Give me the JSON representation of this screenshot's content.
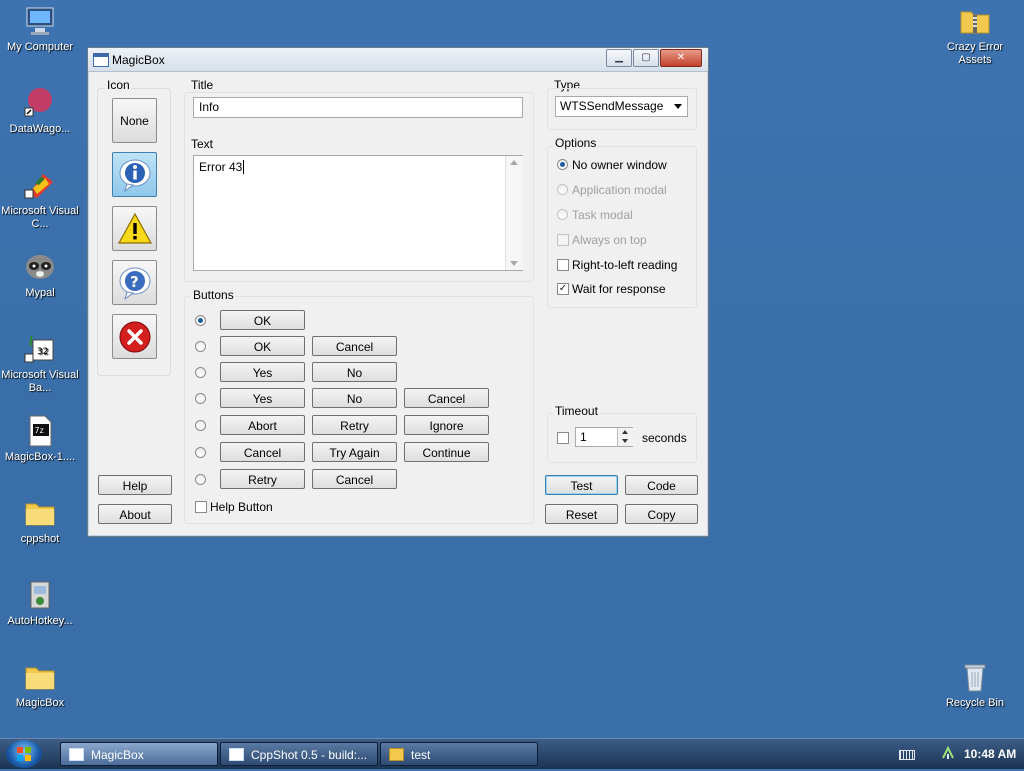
{
  "desktop": {
    "icons_left": [
      {
        "label": "My Computer"
      },
      {
        "label": "DataWago..."
      },
      {
        "label": "Microsoft Visual C..."
      },
      {
        "label": "Mypal"
      },
      {
        "label": "Microsoft Visual Ba..."
      },
      {
        "label": "MagicBox-1...."
      },
      {
        "label": "cppshot"
      },
      {
        "label": "AutoHotkey..."
      },
      {
        "label": "MagicBox"
      }
    ],
    "icons_right": [
      {
        "label": "Crazy Error Assets"
      },
      {
        "label": "Recycle Bin"
      }
    ]
  },
  "window": {
    "title": "MagicBox",
    "controls": {
      "minimize": "▁",
      "maximize": "▢",
      "close": "✕"
    },
    "icon_group": {
      "label": "Icon",
      "none_label": "None",
      "help_label": "Help",
      "about_label": "About"
    },
    "title_field": {
      "label": "Title",
      "value": "Info"
    },
    "text_field": {
      "label": "Text",
      "value": "Error 43"
    },
    "buttons_group": {
      "label": "Buttons",
      "rows": [
        [
          "OK"
        ],
        [
          "OK",
          "Cancel"
        ],
        [
          "Yes",
          "No"
        ],
        [
          "Yes",
          "No",
          "Cancel"
        ],
        [
          "Abort",
          "Retry",
          "Ignore"
        ],
        [
          "Cancel",
          "Try Again",
          "Continue"
        ],
        [
          "Retry",
          "Cancel"
        ]
      ],
      "help_button_label": "Help Button"
    },
    "type": {
      "label": "Type",
      "value": "WTSSendMessage"
    },
    "options": {
      "label": "Options",
      "no_owner": "No owner window",
      "app_modal": "Application modal",
      "task_modal": "Task modal",
      "always_on_top": "Always on top",
      "rtl": "Right-to-left reading",
      "wait": "Wait for response"
    },
    "timeout": {
      "label": "Timeout",
      "value": "1",
      "unit": "seconds"
    },
    "actions": {
      "test": "Test",
      "code": "Code",
      "reset": "Reset",
      "copy": "Copy"
    }
  },
  "taskbar": {
    "tasks": [
      {
        "label": "MagicBox"
      },
      {
        "label": "CppShot 0.5 - build:..."
      },
      {
        "label": "test"
      }
    ],
    "clock": "10:48 AM"
  }
}
